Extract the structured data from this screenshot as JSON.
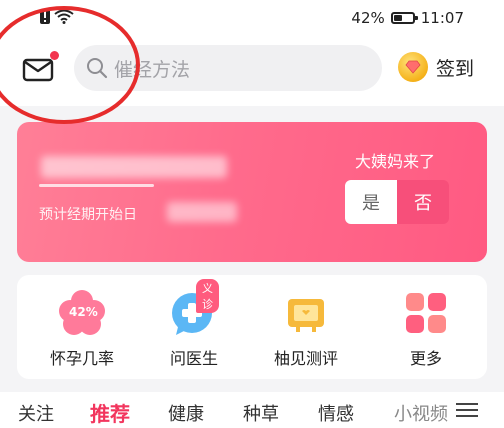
{
  "status_bar": {
    "battery_percent": "42%",
    "time": "11:07",
    "battery_level": 0.42
  },
  "header": {
    "search_placeholder": "催经方法",
    "checkin_label": "签到"
  },
  "period_card": {
    "prediction_hint": "预计经期开始日",
    "question": "大姨妈来了",
    "yes_label": "是",
    "no_label": "否"
  },
  "tools": [
    {
      "label": "怀孕几率",
      "icon": "pregnancy-chance-icon",
      "badge": "42%"
    },
    {
      "label": "问医生",
      "icon": "ask-doctor-icon",
      "tag": "义诊"
    },
    {
      "label": "柚见测评",
      "icon": "review-tv-icon"
    },
    {
      "label": "更多",
      "icon": "more-grid-icon"
    }
  ],
  "tabs": [
    {
      "label": "关注"
    },
    {
      "label": "推荐",
      "active": true
    },
    {
      "label": "健康"
    },
    {
      "label": "种草"
    },
    {
      "label": "情感"
    },
    {
      "label": "小视频"
    }
  ],
  "colors": {
    "accent": "#f2365e",
    "card": "#ff6b8c",
    "annotation": "#e62c2c"
  }
}
